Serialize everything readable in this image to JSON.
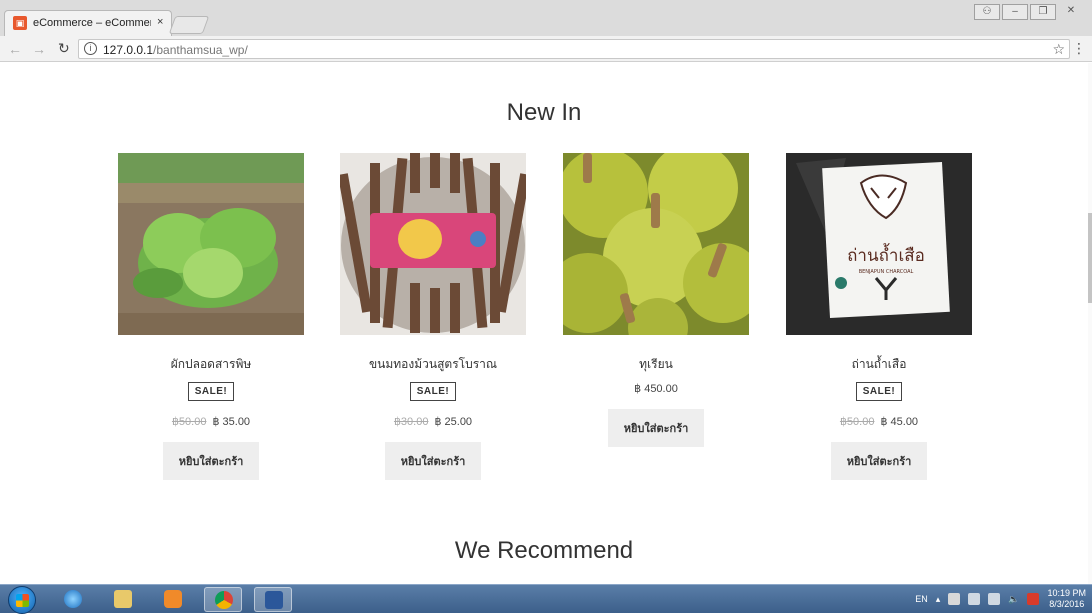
{
  "browser": {
    "tab_title": "eCommerce – eCommerc",
    "tab_close": "×",
    "url_host": "127.0.0.1",
    "url_path": "/banthamsua_wp/"
  },
  "page": {
    "new_in_title": "New In",
    "recommend_title": "We Recommend",
    "products": [
      {
        "name": "ผักปลอดสารพิษ",
        "sale": "SALE!",
        "old_price": "฿50.00",
        "price": "฿ 35.00",
        "button": "หยิบใส่ตะกร้า",
        "on_sale": true
      },
      {
        "name": "ขนมทองม้วนสูตรโบราณ",
        "sale": "SALE!",
        "old_price": "฿30.00",
        "price": "฿ 25.00",
        "button": "หยิบใส่ตะกร้า",
        "on_sale": true
      },
      {
        "name": "ทุเรียน",
        "sale": "",
        "old_price": "",
        "price": "฿ 450.00",
        "button": "หยิบใส่ตะกร้า",
        "on_sale": false
      },
      {
        "name": "ถ่านถ้ำเสือ",
        "sale": "SALE!",
        "old_price": "฿50.00",
        "price": "฿ 45.00",
        "button": "หยิบใส่ตะกร้า",
        "on_sale": true
      }
    ],
    "charcoal_label": "ถ่านถ้ำเสือ",
    "charcoal_sub": "BENJAPUN CHARCOAL"
  },
  "taskbar": {
    "lang": "EN",
    "time": "10:19 PM",
    "date": "8/3/2016"
  },
  "colors": {
    "accent": "#e8582d",
    "taskbar": "#4a6d97"
  }
}
